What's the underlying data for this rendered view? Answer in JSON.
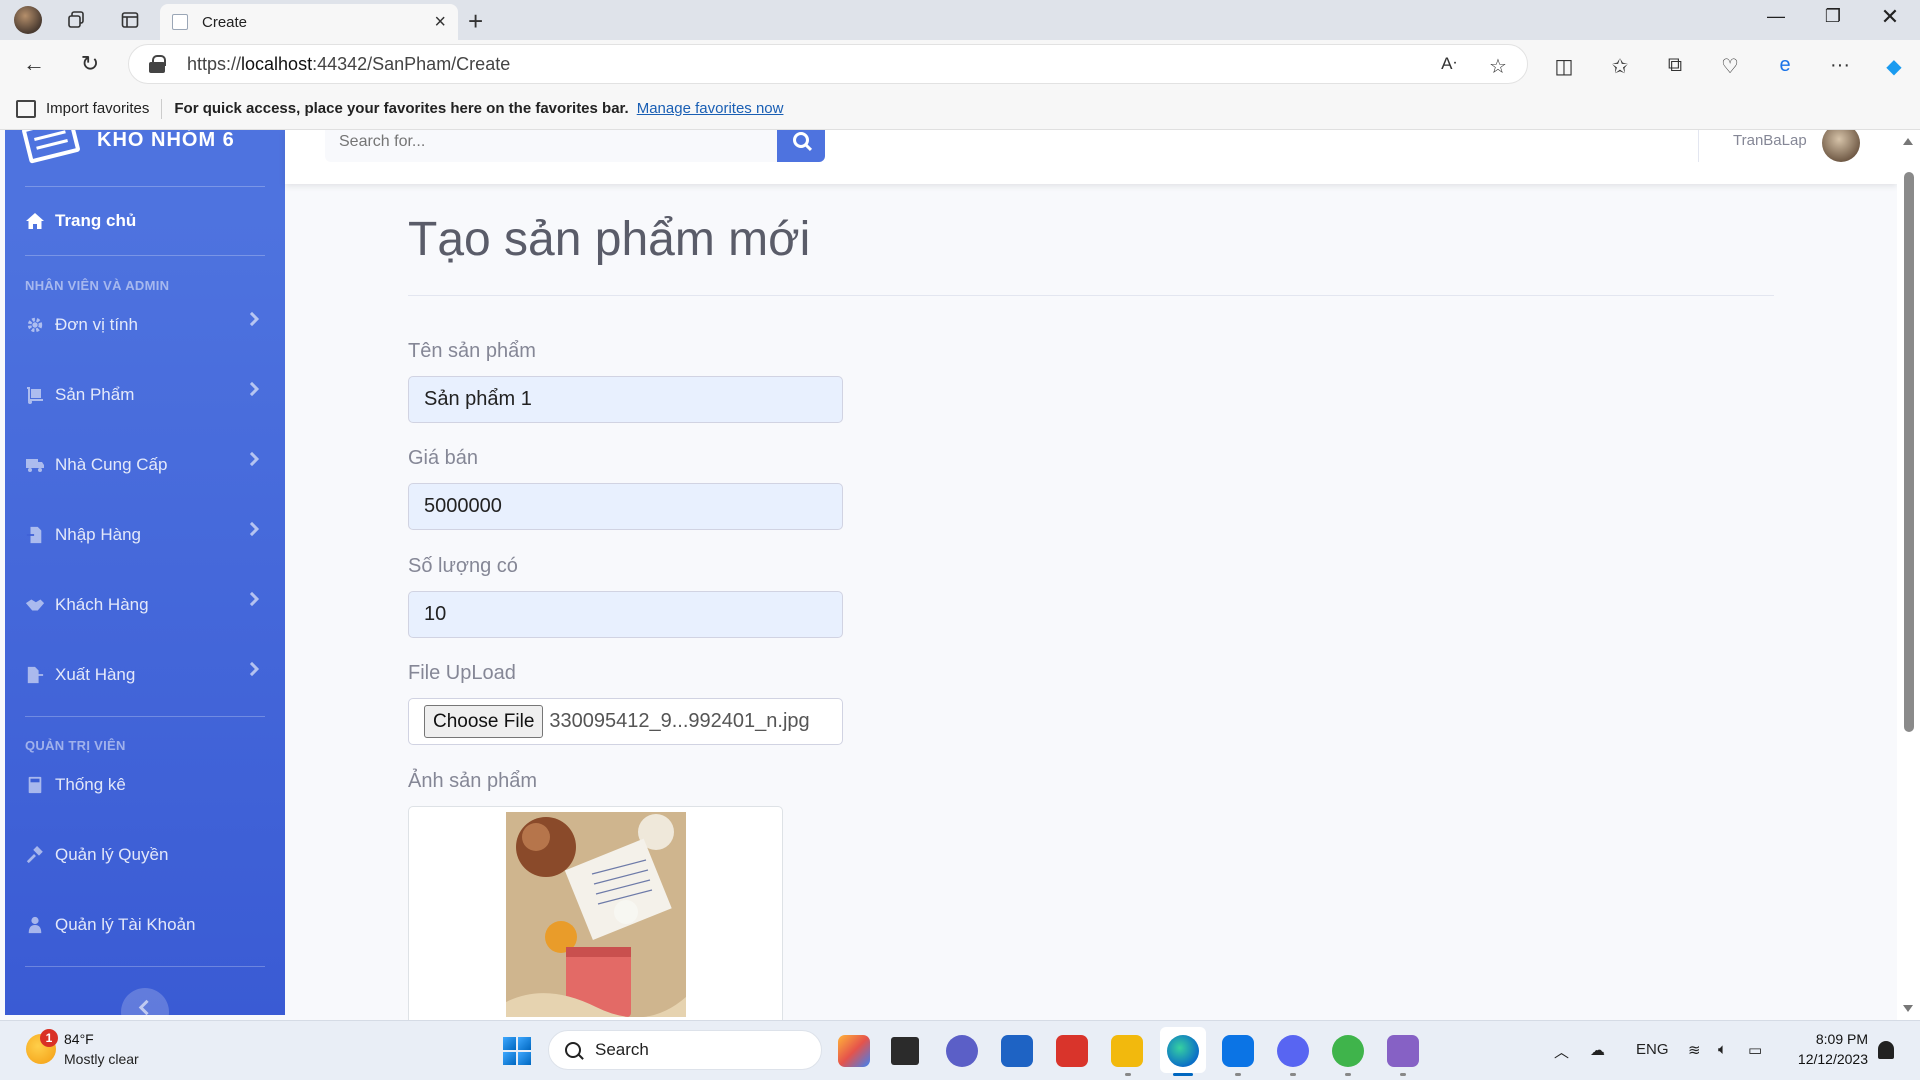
{
  "browser": {
    "tab_title": "Create",
    "url_prefix": "https://",
    "url_host": "localhost",
    "url_rest": ":44342/SanPham/Create",
    "favorites_bar": {
      "import_label": "Import favorites",
      "message": "For quick access, place your favorites here on the favorites bar.",
      "manage_link": "Manage favorites now"
    }
  },
  "sidebar": {
    "brand": "KHO NHÓM 6",
    "home_label": "Trang chủ",
    "section1_heading": "NHÂN VIÊN VÀ ADMIN",
    "section1_items": [
      {
        "label": "Đơn vị tính",
        "icon": "cog-icon"
      },
      {
        "label": "Sản Phẩm",
        "icon": "dolly-icon"
      },
      {
        "label": "Nhà Cung Cấp",
        "icon": "truck-icon"
      },
      {
        "label": "Nhập Hàng",
        "icon": "file-import-icon"
      },
      {
        "label": "Khách Hàng",
        "icon": "handshake-icon"
      },
      {
        "label": "Xuất Hàng",
        "icon": "file-export-icon"
      }
    ],
    "section2_heading": "QUẢN TRỊ VIÊN",
    "section2_items": [
      {
        "label": "Thống kê",
        "icon": "calculator-icon"
      },
      {
        "label": "Quản lý Quyền",
        "icon": "hammer-icon"
      },
      {
        "label": "Quản lý Tài Khoản",
        "icon": "user-icon"
      }
    ]
  },
  "topbar": {
    "search_placeholder": "Search for...",
    "user_name": "TranBaLap"
  },
  "form": {
    "title": "Tạo sản phẩm mới",
    "name_label": "Tên sản phẩm",
    "name_value": "Sản phẩm 1",
    "price_label": "Giá bán",
    "price_value": "5000000",
    "qty_label": "Số lượng có",
    "qty_value": "10",
    "file_label": "File UpLoad",
    "file_button": "Choose File",
    "file_name": "330095412_9...992401_n.jpg",
    "image_label": "Ảnh sản phẩm"
  },
  "taskbar": {
    "weather_badge": "1",
    "weather_temp": "84°F",
    "weather_desc": "Mostly clear",
    "search_label": "Search",
    "language": "ENG",
    "time": "8:09 PM",
    "date": "12/12/2023"
  }
}
